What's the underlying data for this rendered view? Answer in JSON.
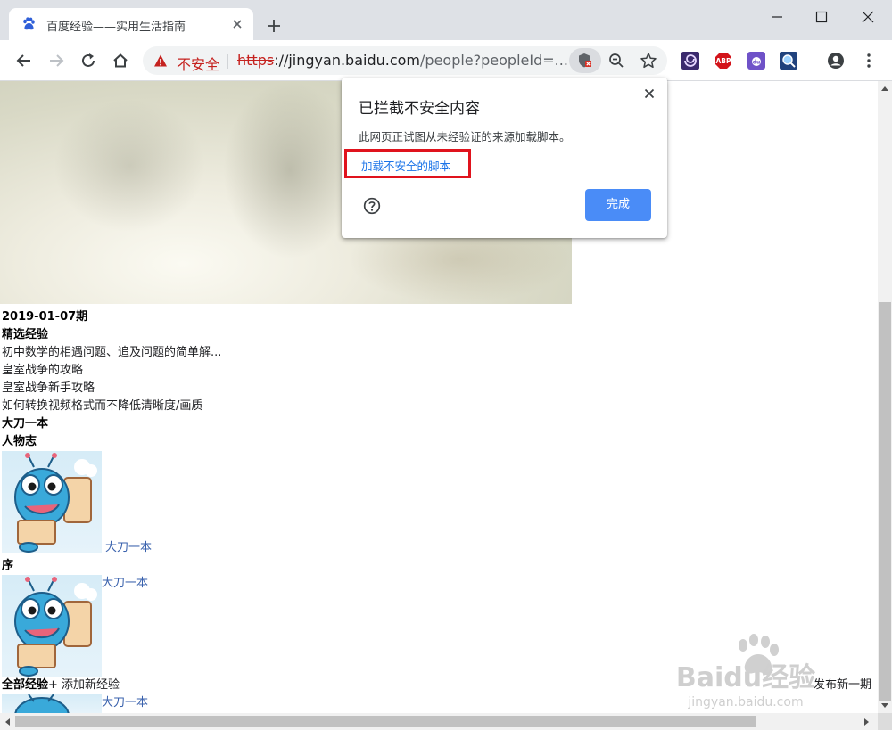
{
  "browser": {
    "tab": {
      "title": "百度经验——实用生活指南"
    },
    "security": {
      "label": "不安全",
      "separator": "|"
    },
    "url": {
      "scheme": "https",
      "host": "://jingyan.baidu.com",
      "path": "/people?peopleId=..."
    },
    "colors": {
      "insecure": "#c5221f",
      "link": "#1a73e8",
      "done_button": "#4a8cf7",
      "highlight_box": "#e0131d"
    },
    "extensions": [
      "spiral-extension-icon",
      "abp-icon",
      "baidu-extension-icon",
      "screenshot-extension-icon"
    ]
  },
  "popup": {
    "title": "已拦截不安全内容",
    "message": "此网页正试图从未经验证的来源加载脚本。",
    "link": "加载不安全的脚本",
    "done": "完成"
  },
  "page": {
    "issue_date": "2019-01-07期",
    "featured_heading": "精选经验",
    "featured_items": [
      "初中数学的相遇问题、追及问题的简单解...",
      "皇室战争的攻略",
      "皇室战争新手攻略",
      "如何转换视频格式而不降低清晰度/画质"
    ],
    "author_name": "大刀一本",
    "profile_heading": "人物志",
    "profile_link": "大刀一本",
    "preface_heading": "序",
    "preface_link": "大刀一本",
    "all_experience": "全部经验",
    "add_experience": "+ 添加新经验",
    "publish_new": "发布新一期",
    "bottom_link": "大刀一本"
  },
  "watermark": {
    "brand": "Baidu经验",
    "domain": "jingyan.baidu.com"
  }
}
